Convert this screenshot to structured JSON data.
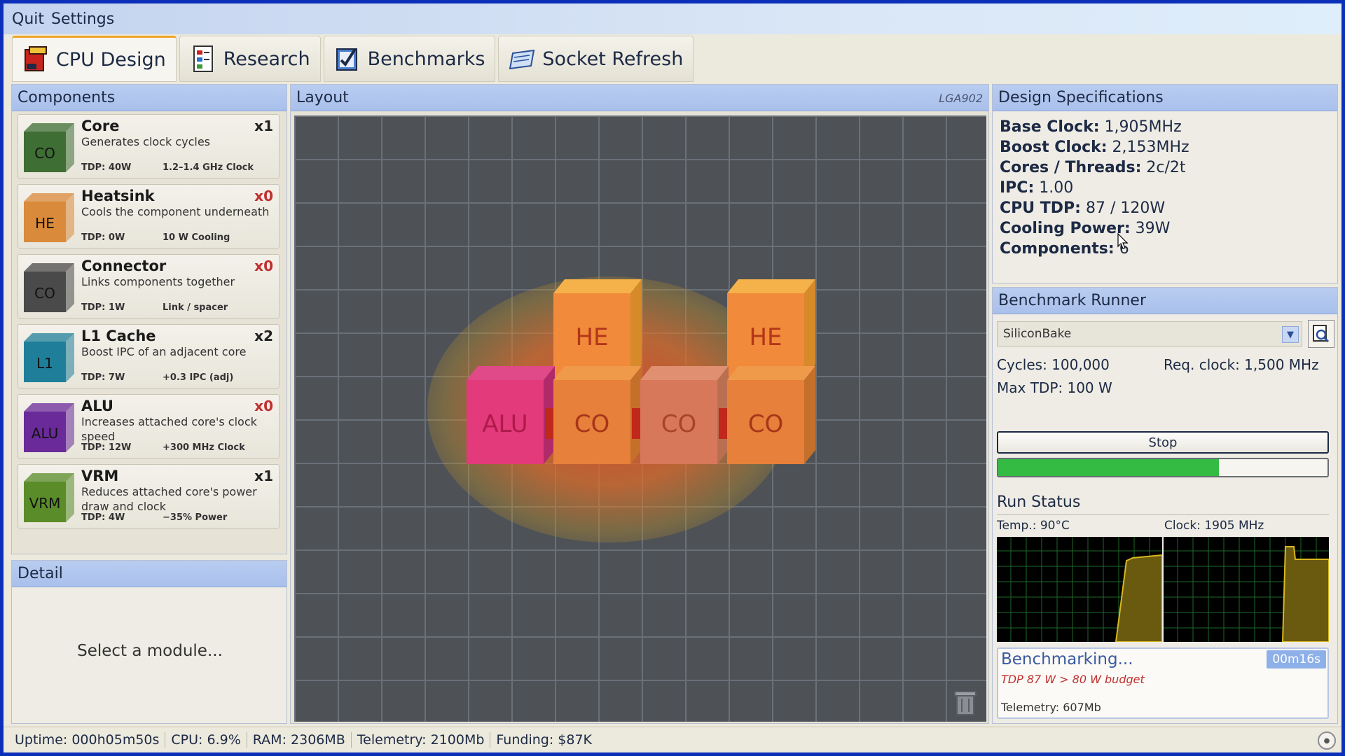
{
  "menu": {
    "items": [
      "Quit",
      "Settings"
    ]
  },
  "tabs": [
    {
      "label": "CPU Design",
      "icon": "cpu-design-icon"
    },
    {
      "label": "Research",
      "icon": "research-icon"
    },
    {
      "label": "Benchmarks",
      "icon": "benchmarks-icon"
    },
    {
      "label": "Socket Refresh",
      "icon": "socket-refresh-icon"
    }
  ],
  "components": {
    "title": "Components",
    "items": [
      {
        "abbr": "CO",
        "name": "Core",
        "desc": "Generates clock cycles",
        "count": "x1",
        "tdp": "TDP: 40W",
        "effect": "1.2–1.4 GHz Clock",
        "color": "#3e6e34"
      },
      {
        "abbr": "HE",
        "name": "Heatsink",
        "desc": "Cools the component underneath",
        "count": "x0",
        "tdp": "TDP: 0W",
        "effect": "10 W Cooling",
        "color": "#d98a3a"
      },
      {
        "abbr": "CO",
        "name": "Connector",
        "desc": "Links components together",
        "count": "x0",
        "tdp": "TDP: 1W",
        "effect": "Link / spacer",
        "color": "#4a4a4a"
      },
      {
        "abbr": "L1",
        "name": "L1 Cache",
        "desc": "Boost IPC of an adjacent core",
        "count": "x2",
        "tdp": "TDP: 7W",
        "effect": "+0.3 IPC (adj)",
        "color": "#1f7f9a"
      },
      {
        "abbr": "ALU",
        "name": "ALU",
        "desc": "Increases attached core's clock speed",
        "count": "x0",
        "tdp": "TDP: 12W",
        "effect": "+300 MHz Clock",
        "color": "#6a2a9a"
      },
      {
        "abbr": "VRM",
        "name": "VRM",
        "desc": "Reduces attached core's power draw and clock",
        "count": "x1",
        "tdp": "TDP: 4W",
        "effect": "−35% Power",
        "color": "#5a8c2a"
      }
    ]
  },
  "detail": {
    "title": "Detail",
    "placeholder": "Select a module..."
  },
  "layout": {
    "title": "Layout",
    "socket": "LGA902",
    "blocks": {
      "he1": "HE",
      "he2": "HE",
      "alu": "ALU",
      "co1": "CO",
      "co2": "CO",
      "co3": "CO"
    }
  },
  "specs": {
    "title": "Design Specifications",
    "rows": [
      {
        "label": "Base Clock:",
        "value": "1,905MHz"
      },
      {
        "label": "Boost Clock:",
        "value": "2,153MHz"
      },
      {
        "label": "Cores / Threads:",
        "value": "2c/2t"
      },
      {
        "label": "IPC:",
        "value": "1.00"
      },
      {
        "label": "CPU TDP:",
        "value": "87 / 120W"
      },
      {
        "label": "Cooling Power:",
        "value": "39W"
      },
      {
        "label": "Components:",
        "value": "6"
      }
    ]
  },
  "benchmark": {
    "title": "Benchmark Runner",
    "selected": "SiliconBake",
    "cycles": "Cycles: 100,000",
    "req_clock": "Req. clock: 1,500 MHz",
    "max_tdp": "Max TDP: 100 W",
    "stop_label": "Stop",
    "progress": 0.67,
    "run_status_title": "Run Status",
    "temp": "Temp.: 90°C",
    "clock": "Clock: 1905 MHz",
    "status_text": "Benchmarking...",
    "timer": "00m16s",
    "warning": "TDP 87 W > 80 W budget",
    "telemetry": "Telemetry: 607Mb"
  },
  "statusbar": {
    "uptime": "Uptime: 000h05m50s",
    "cpu": "CPU: 6.9%",
    "ram": "RAM: 2306MB",
    "telemetry": "Telemetry: 2100Mb",
    "funding": "Funding: $87K"
  }
}
